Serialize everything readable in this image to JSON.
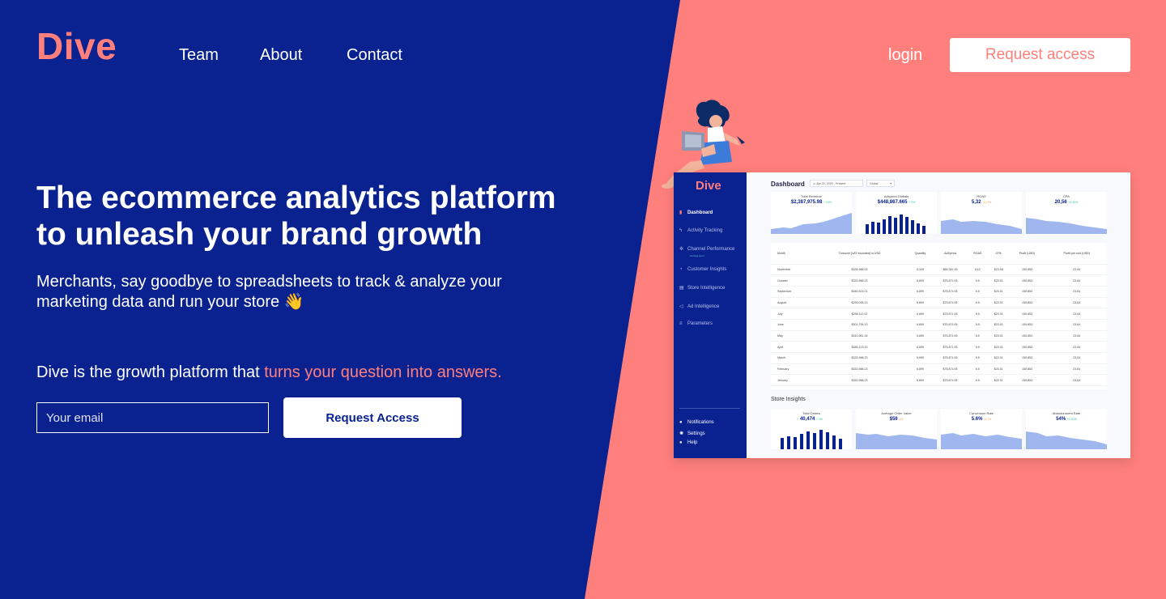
{
  "brand": {
    "name": "Dive",
    "color": "#ff7f7d",
    "blue": "#0a2190"
  },
  "nav": {
    "links": [
      "Team",
      "About",
      "Contact"
    ],
    "login": "login",
    "request_access": "Request access"
  },
  "hero": {
    "headline": "The ecommerce analytics platform to unleash your brand growth",
    "subline": "Merchants, say goodbye to spreadsheets to track & analyze your marketing data and run your store 👋",
    "growth_prefix": "Dive is the growth platform that ",
    "growth_highlight": "turns your question into answers.",
    "email_placeholder": "Your email",
    "cta": "Request Access"
  },
  "dashboard": {
    "logo": "Dive",
    "sidebar": [
      {
        "label": "Dashboard",
        "icon": "bar-chart-icon"
      },
      {
        "label": "Activity Tracking",
        "icon": "lightning-icon"
      },
      {
        "label": "Channel Performance",
        "icon": "network-icon",
        "sub": "Coming soon"
      },
      {
        "label": "Customer Insights",
        "icon": "pie-icon"
      },
      {
        "label": "Store Intelligence",
        "icon": "store-icon"
      },
      {
        "label": "Ad Intelligence",
        "icon": "megaphone-icon"
      },
      {
        "label": "Parameters",
        "icon": "sliders-icon"
      }
    ],
    "sidebar_bottom": [
      {
        "label": "Notifications",
        "icon": "bell-icon"
      },
      {
        "label": "Settings",
        "icon": "gear-icon"
      },
      {
        "label": "Help",
        "icon": "help-icon"
      }
    ],
    "title": "Dashboard",
    "date_range": "Apr 20, 2020 - Present",
    "granularity": "Global",
    "kpis": [
      {
        "label": "Total Revenue",
        "value": "$2,387,975.98",
        "change": "+ 24%",
        "chart": "area"
      },
      {
        "label": "Adspend Globals",
        "value": "$448,867.665",
        "change": "+ 4%",
        "chart": "bars"
      },
      {
        "label": "ROAS",
        "value": "5,32",
        "change": "-11.2%",
        "chart": "area"
      },
      {
        "label": "CPA",
        "value": "20,56",
        "change": "+4.34%",
        "chart": "area"
      }
    ],
    "table": {
      "headers": [
        "Month",
        "Turnover (VAT excluded) in USD",
        "Quantity",
        "AdSpend",
        "ROAS",
        "CPA",
        "Profit (USD)",
        "Profit per unit (USD)"
      ],
      "rows": [
        [
          "November",
          "$326,988.93",
          "5,349",
          "$65,381.45",
          "5.12",
          "$23.98",
          "150,853",
          "23.64"
        ],
        [
          "October",
          "$333,988.23",
          "6,899",
          "$75,871.05",
          "5.5",
          "$23.01",
          "150,853",
          "23.64"
        ],
        [
          "September",
          "$345,923.01",
          "6,899",
          "$75,871.05",
          "5.5",
          "$23.01",
          "150,853",
          "23.64"
        ],
        [
          "August",
          "$299,095.13",
          "6,899",
          "$75,871.05",
          "5.5",
          "$23.01",
          "150,853",
          "23.64"
        ],
        [
          "July",
          "$298,112.02",
          "6,899",
          "$75,871.05",
          "5.5",
          "$23.01",
          "150,853",
          "23.64"
        ],
        [
          "June",
          "$301,754.13",
          "6,899",
          "$75,871.05",
          "5.5",
          "$23.01",
          "150,853",
          "23.64"
        ],
        [
          "May",
          "$310,981.34",
          "5,899",
          "$75,871.05",
          "5.5",
          "$23.01",
          "150,853",
          "23.64"
        ],
        [
          "April",
          "$285,123.43",
          "6,899",
          "$75,871.05",
          "5.5",
          "$23.01",
          "150,853",
          "23.64"
        ],
        [
          "March",
          "$333,988.23",
          "6,899",
          "$75,871.05",
          "5.5",
          "$23.01",
          "150,853",
          "23.64"
        ],
        [
          "February",
          "$333,988.23",
          "6,899",
          "$75,871.05",
          "5.5",
          "$23.01",
          "150,853",
          "23.64"
        ],
        [
          "January",
          "$333,988.23",
          "6,899",
          "$75,871.05",
          "5.5",
          "$22.01",
          "150,853",
          "23.64"
        ]
      ]
    },
    "store_insights_title": "Store Insights",
    "store_kpis": [
      {
        "label": "Total Orders",
        "value": "40,474",
        "change": "+ 4%",
        "chart": "bars"
      },
      {
        "label": "Average Order Value",
        "value": "$59",
        "change": "4%",
        "chart": "area"
      },
      {
        "label": "Conversion Rate",
        "value": "5.6%",
        "change": "-4.2%",
        "chart": "area"
      },
      {
        "label": "Abandonment Rate",
        "value": "54%",
        "change": "+2.52%",
        "chart": "area"
      }
    ]
  }
}
